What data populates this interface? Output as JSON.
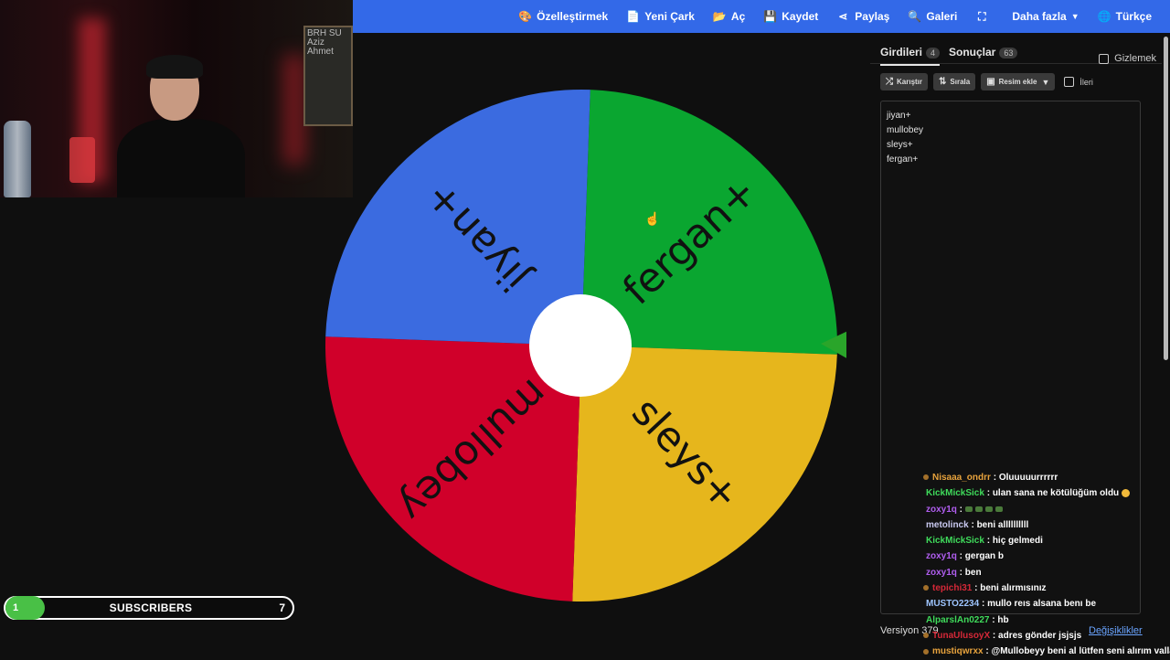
{
  "menu": {
    "items": [
      {
        "icon": "palette-icon",
        "glyph": "🎨",
        "label": "Özelleştirmek"
      },
      {
        "icon": "file-icon",
        "glyph": "📄",
        "label": "Yeni Çark"
      },
      {
        "icon": "folder-open-icon",
        "glyph": "📂",
        "label": "Aç"
      },
      {
        "icon": "save-icon",
        "glyph": "💾",
        "label": "Kaydet"
      },
      {
        "icon": "share-icon",
        "glyph": "⋖",
        "label": "Paylaş"
      },
      {
        "icon": "search-icon",
        "glyph": "🔍",
        "label": "Galeri"
      },
      {
        "icon": "fullscreen-icon",
        "glyph": "⛶",
        "label": ""
      },
      {
        "icon": "chevron-down-icon",
        "glyph": "",
        "label": "Daha fazla"
      },
      {
        "icon": "globe-icon",
        "glyph": "🌐",
        "label": "Türkçe"
      }
    ]
  },
  "webcam": {
    "board_text": "BRH SU Aziz Ahmet"
  },
  "wheel": {
    "segments": [
      {
        "label": "fergan+",
        "color": "#0aa630"
      },
      {
        "label": "sleys+",
        "color": "#e6b61c"
      },
      {
        "label": "mullobey",
        "color": "#d0002a"
      },
      {
        "label": "jiyan+",
        "color": "#3b6be0"
      }
    ],
    "pointer_color": "#2aa52a",
    "hub_color": "#ffffff"
  },
  "sidebar": {
    "tab_entries": "Girdileri",
    "tab_entries_count": "4",
    "tab_results": "Sonuçlar",
    "tab_results_count": "63",
    "hide_label": "Gizlemek",
    "shuffle_label": "Karıştır",
    "sort_label": "Sırala",
    "add_image_label": "Resim ekle",
    "advanced_label": "İleri",
    "entries": [
      "jiyan+",
      "mullobey",
      "sleys+",
      "fergan+"
    ],
    "version": "Versiyon 379",
    "changes": "Değişiklikler"
  },
  "chat": [
    {
      "user": "Nisaaa_ondrr",
      "color": "#e8a33d",
      "badge": true,
      "msg": "Oluuuuurrrrrr"
    },
    {
      "user": "KickMickSick",
      "color": "#3fdb5b",
      "msg": "ulan sana ne kötülüğüm oldu",
      "smile": true
    },
    {
      "user": "zoxy1q",
      "color": "#b15ef0",
      "msg": "",
      "emotes": 4
    },
    {
      "user": "metolinck",
      "color": "#c9c9f0",
      "msg": "beni allllllllll"
    },
    {
      "user": "KickMickSick",
      "color": "#3fdb5b",
      "msg": "hiç gelmedi"
    },
    {
      "user": "zoxy1q",
      "color": "#b15ef0",
      "msg": "gergan b"
    },
    {
      "user": "zoxy1q",
      "color": "#b15ef0",
      "msg": "ben"
    },
    {
      "user": "tepichi31",
      "color": "#d62838",
      "badge": true,
      "msg": "beni alırmısınız"
    },
    {
      "user": "MUSTO2234",
      "color": "#9ec5ff",
      "msg": "mullo reıs alsana benı be"
    },
    {
      "user": "AlparslAn0227",
      "color": "#3fdb5b",
      "msg": "hb"
    },
    {
      "user": "TunaUlusoyX",
      "color": "#d62838",
      "badge": true,
      "msg": "adres gönder jsjsjs"
    },
    {
      "user": "mustiqwrxx",
      "color": "#e8a33d",
      "badge": true,
      "msg": "@Mullobeyy beni al lütfen seni alırım valla"
    }
  ],
  "subscribers": {
    "current": "1",
    "label": "SUBSCRIBERS",
    "goal": "7",
    "progress": 0.14
  }
}
